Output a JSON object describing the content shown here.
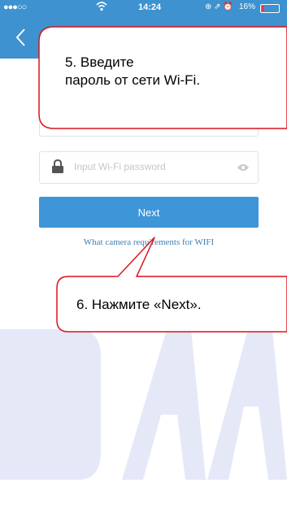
{
  "status_bar": {
    "signal": "●●●○○",
    "wifi_icon": "wifi-icon",
    "time": "14:24",
    "indicators": "⊕ ⇗ ⏰",
    "battery_percent": "16%",
    "battery_level": 0.16
  },
  "nav": {
    "back_icon": "chevron-left-icon"
  },
  "form": {
    "password_placeholder": "Input Wi-Fi password",
    "next_label": "Next",
    "help_link": "What camera requirements for WIFI"
  },
  "callouts": {
    "step5_line1": "5. Введите",
    "step5_line2": "пароль от сети Wi-Fi.",
    "step6": "6. Нажмите «Next»."
  },
  "colors": {
    "header": "#3d92cf",
    "button": "#3e95d8",
    "callout_border": "#d9141c",
    "watermark": "#4a5fc8"
  }
}
